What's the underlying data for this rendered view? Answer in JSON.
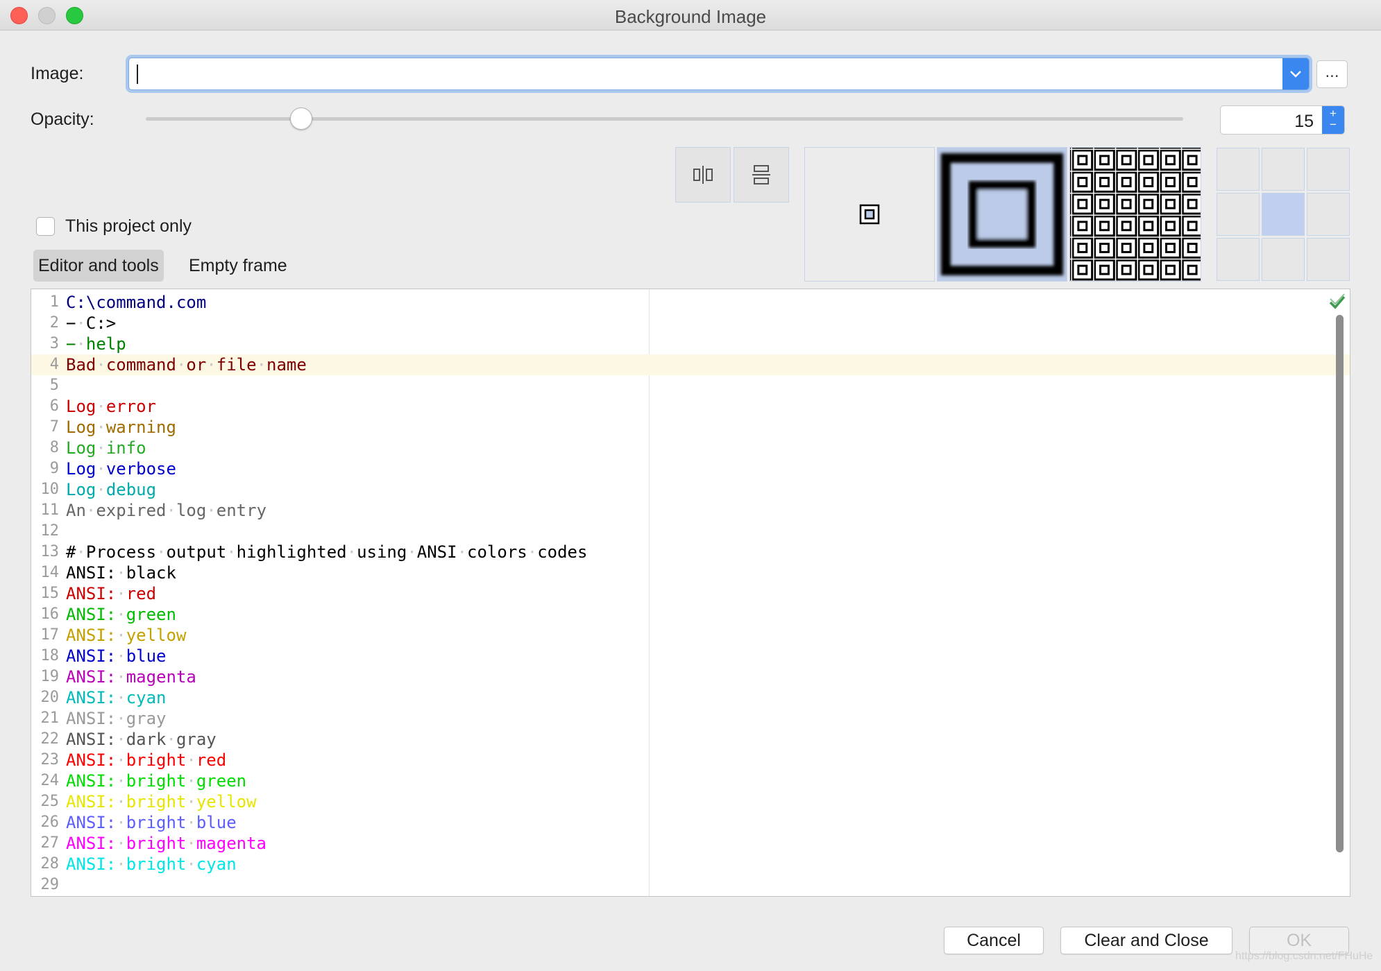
{
  "window": {
    "title": "Background Image"
  },
  "image": {
    "label": "Image:",
    "value": "",
    "browse_label": "..."
  },
  "opacity": {
    "label": "Opacity:",
    "value": "15",
    "slider_level_percent": 15,
    "spinner_plus": "+",
    "spinner_minus": "−"
  },
  "options": {
    "project_only_label": "This project only",
    "project_only_checked": false
  },
  "tabs": [
    {
      "label": "Editor and tools",
      "active": true
    },
    {
      "label": "Empty frame",
      "active": false
    }
  ],
  "editor": {
    "lines": [
      {
        "n": "1",
        "text": "C:\\command.com",
        "color": "#000080"
      },
      {
        "n": "2",
        "text": "−·C:>",
        "color": "#000000"
      },
      {
        "n": "3",
        "text": "−·help",
        "color": "#008000"
      },
      {
        "n": "4",
        "text": "Bad·command·or·file·name",
        "color": "#7f0000"
      },
      {
        "n": "5",
        "text": "",
        "color": "#000000"
      },
      {
        "n": "6",
        "text": "Log·error",
        "color": "#cc0000"
      },
      {
        "n": "7",
        "text": "Log·warning",
        "color": "#a06b00"
      },
      {
        "n": "8",
        "text": "Log·info",
        "color": "#22aa22"
      },
      {
        "n": "9",
        "text": "Log·verbose",
        "color": "#0000cc"
      },
      {
        "n": "10",
        "text": "Log·debug",
        "color": "#00aaaa"
      },
      {
        "n": "11",
        "text": "An·expired·log·entry",
        "color": "#666666"
      },
      {
        "n": "12",
        "text": "",
        "color": "#000000"
      },
      {
        "n": "13",
        "text": "#·Process·output·highlighted·using·ANSI·colors·codes",
        "color": "#000000"
      },
      {
        "n": "14",
        "text": "ANSI:·black",
        "color": "#000000"
      },
      {
        "n": "15",
        "text": "ANSI:·red",
        "color": "#cc0000"
      },
      {
        "n": "16",
        "text": "ANSI:·green",
        "color": "#00bb00"
      },
      {
        "n": "17",
        "text": "ANSI:·yellow",
        "color": "#c4a000"
      },
      {
        "n": "18",
        "text": "ANSI:·blue",
        "color": "#0000cc"
      },
      {
        "n": "19",
        "text": "ANSI:·magenta",
        "color": "#bb00bb"
      },
      {
        "n": "20",
        "text": "ANSI:·cyan",
        "color": "#00bbbb"
      },
      {
        "n": "21",
        "text": "ANSI:·gray",
        "color": "#999999"
      },
      {
        "n": "22",
        "text": "ANSI:·dark·gray",
        "color": "#555555"
      },
      {
        "n": "23",
        "text": "ANSI:·bright·red",
        "color": "#ff0000"
      },
      {
        "n": "24",
        "text": "ANSI:·bright·green",
        "color": "#00dd00"
      },
      {
        "n": "25",
        "text": "ANSI:·bright·yellow",
        "color": "#e6e600"
      },
      {
        "n": "26",
        "text": "ANSI:·bright·blue",
        "color": "#5c5cff"
      },
      {
        "n": "27",
        "text": "ANSI:·bright·magenta",
        "color": "#ff00ff"
      },
      {
        "n": "28",
        "text": "ANSI:·bright·cyan",
        "color": "#00e5e5"
      },
      {
        "n": "29",
        "text": "",
        "color": "#000000"
      }
    ],
    "current_line": "4"
  },
  "buttons": {
    "cancel": "Cancel",
    "clear_close": "Clear and Close",
    "ok": "OK"
  },
  "colors": {
    "accent": "#3a87f0",
    "selection": "#bccbe8",
    "current_line_bg": "#fdf8e4",
    "check": "#3d9a4e"
  },
  "watermark": "https://blog.csdn.net/FHuHe"
}
